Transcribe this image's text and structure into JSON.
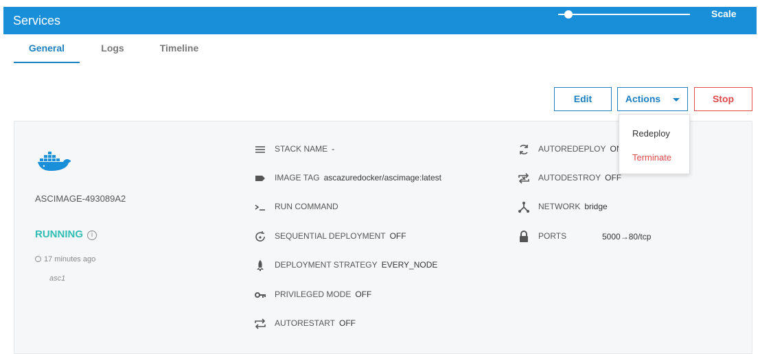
{
  "header": {
    "title": "Services",
    "scale_label": "Scale",
    "scale_value_pct": 8
  },
  "tabs": [
    {
      "label": "General"
    },
    {
      "label": "Logs"
    },
    {
      "label": "Timeline"
    }
  ],
  "toolbar": {
    "edit_label": "Edit",
    "actions_label": "Actions",
    "stop_label": "Stop"
  },
  "actions_menu": {
    "redeploy": "Redeploy",
    "terminate": "Terminate"
  },
  "service": {
    "name": "ASCIMAGE-493089A2",
    "status": "RUNNING",
    "time": "17 minutes ago",
    "node": "asc1"
  },
  "details": {
    "stack_name": {
      "label": "STACK NAME",
      "value": "-"
    },
    "image_tag": {
      "label": "IMAGE TAG",
      "value": "ascazuredocker/ascimage:latest"
    },
    "run_command": {
      "label": "RUN COMMAND",
      "value": ""
    },
    "sequential_deployment": {
      "label": "SEQUENTIAL DEPLOYMENT",
      "value": "OFF"
    },
    "deployment_strategy": {
      "label": "DEPLOYMENT STRATEGY",
      "value": "EVERY_NODE"
    },
    "privileged_mode": {
      "label": "PRIVILEGED MODE",
      "value": "OFF"
    },
    "autorestart": {
      "label": "AUTORESTART",
      "value": "OFF"
    },
    "autoredeploy": {
      "label": "AUTOREDEPLOY",
      "value": "ON"
    },
    "autodestroy": {
      "label": "AUTODESTROY",
      "value": "OFF"
    },
    "network": {
      "label": "NETWORK",
      "value": "bridge"
    },
    "ports": {
      "label": "PORTS",
      "value": "5000→80/tcp"
    }
  },
  "colors": {
    "header_bg": "#1a8fd9",
    "accent": "#1a7fc0",
    "running": "#2fbdb3",
    "danger": "#e04a4a"
  },
  "icons": [
    "docker-icon",
    "info-icon",
    "clock-icon",
    "stack-icon",
    "tag-icon",
    "terminal-icon",
    "sequential-icon",
    "rocket-icon",
    "key-icon",
    "autorestart-icon",
    "autoredeploy-icon",
    "autodestroy-icon",
    "network-icon",
    "lock-icon"
  ]
}
